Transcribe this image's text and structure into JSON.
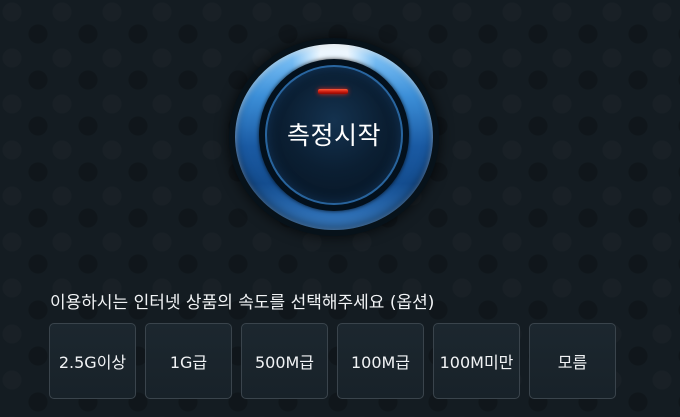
{
  "start_button": {
    "label": "측정시작"
  },
  "speed_prompt": "이용하시는 인터넷 상품의 속도를 선택해주세요 (옵션)",
  "speed_options": [
    {
      "label": "2.5G이상"
    },
    {
      "label": "1G급"
    },
    {
      "label": "500M급"
    },
    {
      "label": "100M급"
    },
    {
      "label": "100M미만"
    },
    {
      "label": "모름"
    }
  ],
  "colors": {
    "background": "#141c22",
    "ring_blue": "#3c8fd8",
    "indicator_red": "#c5170c",
    "option_border": "#3a444c"
  }
}
